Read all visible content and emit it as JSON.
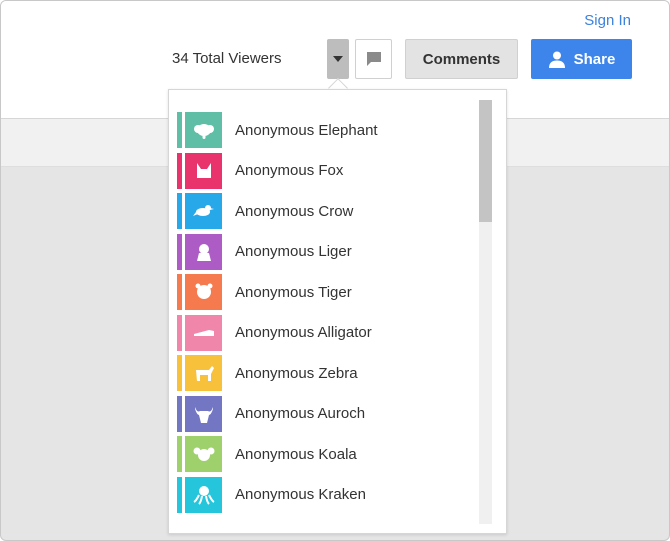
{
  "header": {
    "sign_in_label": "Sign In",
    "viewers_text": "34 Total Viewers",
    "comments_label": "Comments",
    "share_label": "Share"
  },
  "viewers": [
    {
      "name": "Anonymous Elephant",
      "icon": "elephant-icon",
      "color": "#5fbfa6"
    },
    {
      "name": "Anonymous Fox",
      "icon": "fox-icon",
      "color": "#e8336d"
    },
    {
      "name": "Anonymous Crow",
      "icon": "crow-icon",
      "color": "#27a9e9"
    },
    {
      "name": "Anonymous Liger",
      "icon": "liger-icon",
      "color": "#ad5cc6"
    },
    {
      "name": "Anonymous Tiger",
      "icon": "tiger-icon",
      "color": "#f57b4e"
    },
    {
      "name": "Anonymous Alligator",
      "icon": "alligator-icon",
      "color": "#f087ab"
    },
    {
      "name": "Anonymous Zebra",
      "icon": "zebra-icon",
      "color": "#f7c13b"
    },
    {
      "name": "Anonymous Auroch",
      "icon": "auroch-icon",
      "color": "#7276c3"
    },
    {
      "name": "Anonymous Koala",
      "icon": "koala-icon",
      "color": "#9ed06c"
    },
    {
      "name": "Anonymous Kraken",
      "icon": "kraken-icon",
      "color": "#25c5dc"
    }
  ],
  "colors": {
    "accent": "#3d85ea",
    "link": "#3b82dc"
  }
}
